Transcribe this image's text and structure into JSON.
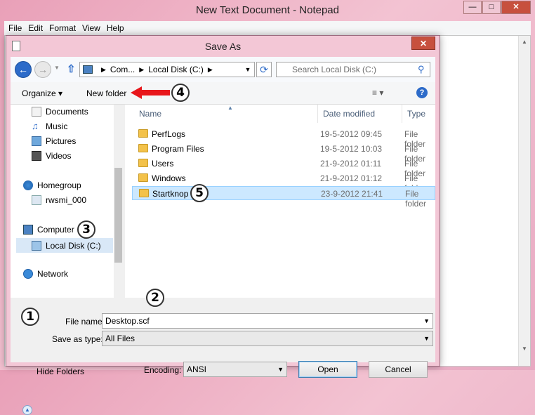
{
  "notepad": {
    "title": "New Text Document - Notepad",
    "menu": [
      "File",
      "Edit",
      "Format",
      "View",
      "Help"
    ]
  },
  "dialog": {
    "title": "Save As",
    "address": {
      "parts": [
        "Com...",
        "Local Disk (C:)"
      ]
    },
    "search_placeholder": "Search Local Disk (C:)",
    "toolbar": {
      "organize": "Organize",
      "new_folder": "New folder"
    },
    "nav": {
      "items": [
        "Documents",
        "Music",
        "Pictures",
        "Videos",
        "Homegroup",
        "rwsmi_000",
        "Computer",
        "Local Disk (C:)",
        "Network"
      ]
    },
    "columns": {
      "name": "Name",
      "date": "Date modified",
      "type": "Type"
    },
    "files": [
      {
        "name": "PerfLogs",
        "date": "19-5-2012 09:45",
        "type": "File folder"
      },
      {
        "name": "Program Files",
        "date": "19-5-2012 10:03",
        "type": "File folder"
      },
      {
        "name": "Users",
        "date": "21-9-2012 01:11",
        "type": "File folder"
      },
      {
        "name": "Windows",
        "date": "21-9-2012 01:12",
        "type": "File folder"
      },
      {
        "name": "Startknop",
        "date": "23-9-2012 21:41",
        "type": "File folder"
      }
    ],
    "file_name_label": "File name:",
    "file_name_value": "Desktop.scf",
    "save_type_label": "Save as type:",
    "save_type_value": "All Files",
    "hide_folders": "Hide Folders",
    "encoding_label": "Encoding:",
    "encoding_value": "ANSI",
    "open_button": "Open",
    "cancel_button": "Cancel"
  },
  "annotations": [
    "1",
    "2",
    "3",
    "4",
    "5"
  ],
  "colors": {
    "annotation_arrow": "#e8161b",
    "selection": "#cce8ff",
    "accent": "#2d6bc9"
  }
}
